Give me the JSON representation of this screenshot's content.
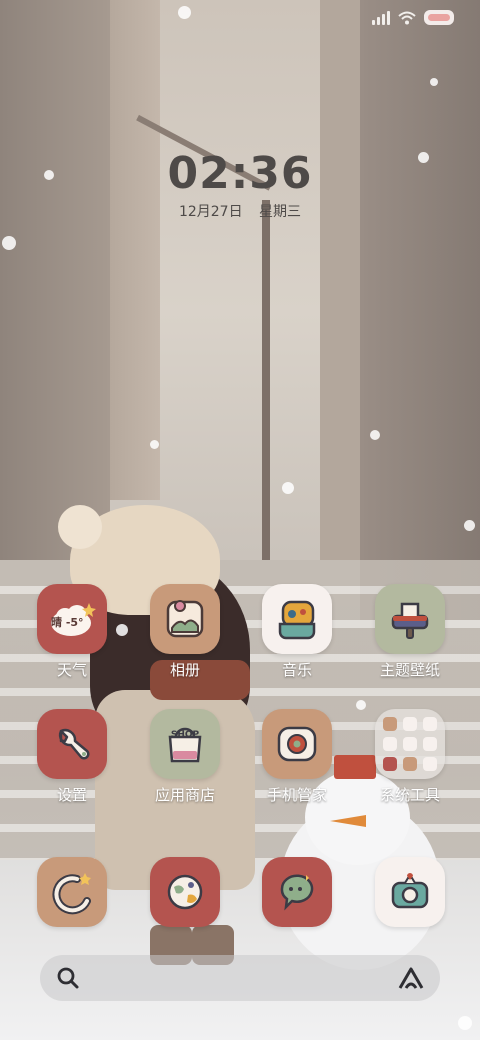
{
  "clock": {
    "time": "02:36",
    "date": "12月27日",
    "weekday": "星期三"
  },
  "status_bar": {
    "battery_color": "#e9a3a0"
  },
  "apps_row1": [
    {
      "label": "天气",
      "icon": "weather-icon",
      "badge": "晴 -5°",
      "color": "#b4544f"
    },
    {
      "label": "相册",
      "icon": "gallery-icon",
      "color": "#c89a7a"
    },
    {
      "label": "音乐",
      "icon": "music-icon",
      "color": "#f7f1ee"
    },
    {
      "label": "主题壁纸",
      "icon": "theme-brush-icon",
      "color": "#b3b99f"
    }
  ],
  "apps_row2": [
    {
      "label": "设置",
      "icon": "settings-icon",
      "color": "#b4544f"
    },
    {
      "label": "应用商店",
      "icon": "app-store-icon",
      "badge": "SHOP",
      "color": "#b3b99f"
    },
    {
      "label": "手机管家",
      "icon": "phone-manager-icon",
      "color": "#c89a7a"
    },
    {
      "label": "系统工具",
      "icon": "folder-icon",
      "color": "#e6e2de"
    }
  ],
  "dock": [
    {
      "icon": "phone-icon",
      "color": "#c89a7a"
    },
    {
      "icon": "browser-globe-icon",
      "color": "#b4544f"
    },
    {
      "icon": "messages-icon",
      "color": "#b4544f"
    },
    {
      "icon": "camera-icon",
      "color": "#f7f1ee"
    }
  ],
  "search": {
    "icon": "search-icon",
    "assistant_icon": "assistant-icon"
  }
}
